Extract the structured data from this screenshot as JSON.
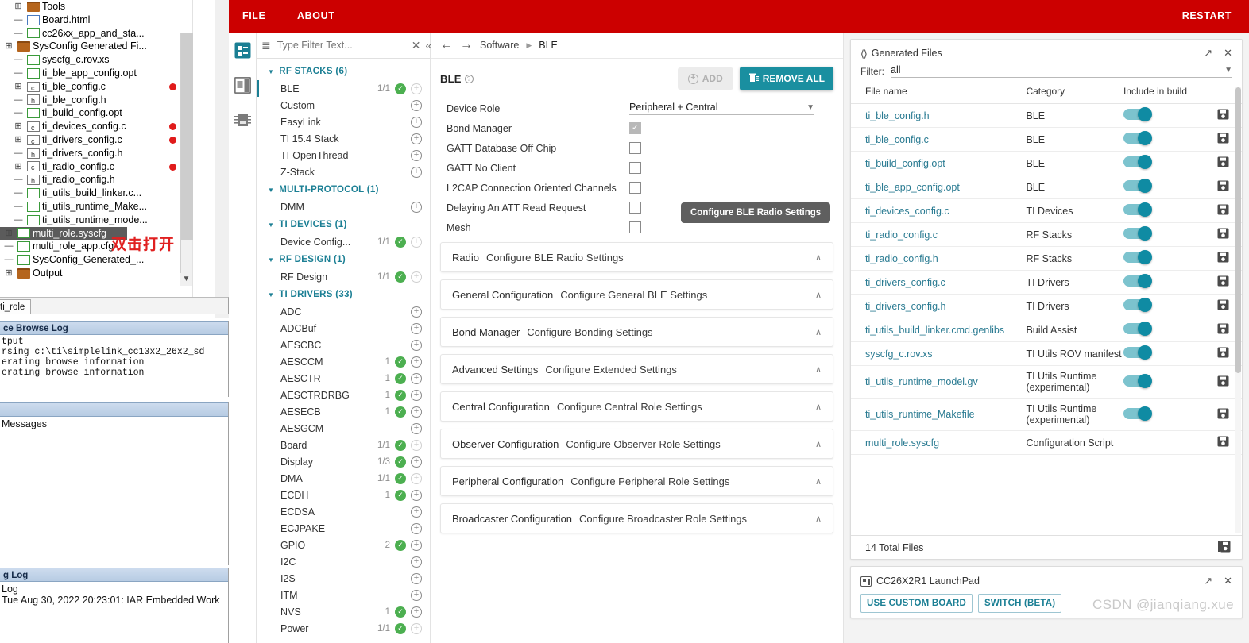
{
  "ide": {
    "tree": [
      {
        "depth": 1,
        "expander": "+",
        "icon": "folder",
        "label": "Tools",
        "dot": false
      },
      {
        "depth": 1,
        "expander": "-",
        "icon": "html",
        "label": "Board.html",
        "dot": false
      },
      {
        "depth": 1,
        "expander": "-",
        "icon": "file",
        "label": "cc26xx_app_and_sta...",
        "dot": false
      },
      {
        "depth": 0,
        "expander": "+",
        "icon": "folder",
        "label": "SysConfig Generated Fi...",
        "dot": false
      },
      {
        "depth": 1,
        "expander": "-",
        "icon": "file",
        "label": "syscfg_c.rov.xs",
        "dot": false
      },
      {
        "depth": 1,
        "expander": "-",
        "icon": "file",
        "label": "ti_ble_app_config.opt",
        "dot": false
      },
      {
        "depth": 1,
        "expander": "+",
        "icon": "c",
        "label": "ti_ble_config.c",
        "dot": true
      },
      {
        "depth": 1,
        "expander": "-",
        "icon": "h",
        "label": "ti_ble_config.h",
        "dot": false
      },
      {
        "depth": 1,
        "expander": "-",
        "icon": "file",
        "label": "ti_build_config.opt",
        "dot": false
      },
      {
        "depth": 1,
        "expander": "+",
        "icon": "c",
        "label": "ti_devices_config.c",
        "dot": true
      },
      {
        "depth": 1,
        "expander": "+",
        "icon": "c",
        "label": "ti_drivers_config.c",
        "dot": true
      },
      {
        "depth": 1,
        "expander": "-",
        "icon": "h",
        "label": "ti_drivers_config.h",
        "dot": false
      },
      {
        "depth": 1,
        "expander": "+",
        "icon": "c",
        "label": "ti_radio_config.c",
        "dot": true
      },
      {
        "depth": 1,
        "expander": "-",
        "icon": "h",
        "label": "ti_radio_config.h",
        "dot": false
      },
      {
        "depth": 1,
        "expander": "-",
        "icon": "file",
        "label": "ti_utils_build_linker.c...",
        "dot": false
      },
      {
        "depth": 1,
        "expander": "-",
        "icon": "file",
        "label": "ti_utils_runtime_Make...",
        "dot": false
      },
      {
        "depth": 1,
        "expander": "-",
        "icon": "file",
        "label": "ti_utils_runtime_mode...",
        "dot": false
      },
      {
        "depth": 0,
        "expander": "+",
        "icon": "file",
        "label": "multi_role.syscfg",
        "dot": false,
        "selected": true
      },
      {
        "depth": 0,
        "expander": "-",
        "icon": "file",
        "label": "multi_role_app.cfg",
        "dot": false
      },
      {
        "depth": 0,
        "expander": "-",
        "icon": "file",
        "label": "SysConfig_Generated_...",
        "dot": false
      },
      {
        "depth": 0,
        "expander": "+",
        "icon": "folder",
        "label": "Output",
        "dot": false
      }
    ],
    "annotation": "双击打开",
    "project_tab": "ti_role",
    "panes": [
      {
        "title": "ce Browse Log",
        "lines": [
          "tput",
          "rsing c:\\ti\\simplelink_cc13x2_26x2_sd",
          "erating browse information",
          "erating browse information"
        ],
        "mono": true
      },
      {
        "title": "",
        "lines": [
          "Messages"
        ],
        "mono": false
      },
      {
        "title": "g Log",
        "lines": [
          "Log",
          "Tue Aug 30, 2022 20:23:01: IAR Embedded Work"
        ],
        "mono": false
      }
    ]
  },
  "app": {
    "topbar": {
      "file": "FILE",
      "about": "ABOUT",
      "restart": "RESTART"
    },
    "rail": [
      {
        "name": "modules-icon"
      },
      {
        "name": "board-view-icon"
      },
      {
        "name": "chip-icon"
      }
    ],
    "filter": {
      "placeholder": "Type Filter Text...",
      "value": ""
    },
    "module_tree": [
      {
        "type": "group",
        "label": "RF STACKS (6)"
      },
      {
        "type": "item",
        "label": "BLE",
        "count": "1/1",
        "ok": true,
        "active": true,
        "plus_dim": true
      },
      {
        "type": "item",
        "label": "Custom",
        "count": "",
        "ok": false,
        "plus_dim": false
      },
      {
        "type": "item",
        "label": "EasyLink",
        "count": "",
        "ok": false,
        "plus_dim": false
      },
      {
        "type": "item",
        "label": "TI 15.4 Stack",
        "count": "",
        "ok": false,
        "plus_dim": false
      },
      {
        "type": "item",
        "label": "TI-OpenThread",
        "count": "",
        "ok": false,
        "plus_dim": false
      },
      {
        "type": "item",
        "label": "Z-Stack",
        "count": "",
        "ok": false,
        "plus_dim": false
      },
      {
        "type": "group",
        "label": "MULTI-PROTOCOL (1)"
      },
      {
        "type": "item",
        "label": "DMM",
        "count": "",
        "ok": false,
        "plus_dim": false
      },
      {
        "type": "group",
        "label": "TI DEVICES (1)"
      },
      {
        "type": "item",
        "label": "Device Config...",
        "count": "1/1",
        "ok": true,
        "plus_dim": true
      },
      {
        "type": "group",
        "label": "RF DESIGN (1)"
      },
      {
        "type": "item",
        "label": "RF Design",
        "count": "1/1",
        "ok": true,
        "plus_dim": true
      },
      {
        "type": "group",
        "label": "TI DRIVERS (33)"
      },
      {
        "type": "item",
        "label": "ADC",
        "count": "",
        "ok": false,
        "plus_dim": false
      },
      {
        "type": "item",
        "label": "ADCBuf",
        "count": "",
        "ok": false,
        "plus_dim": false
      },
      {
        "type": "item",
        "label": "AESCBC",
        "count": "",
        "ok": false,
        "plus_dim": false
      },
      {
        "type": "item",
        "label": "AESCCM",
        "count": "1",
        "ok": true,
        "plus_dim": false
      },
      {
        "type": "item",
        "label": "AESCTR",
        "count": "1",
        "ok": true,
        "plus_dim": false
      },
      {
        "type": "item",
        "label": "AESCTRDRBG",
        "count": "1",
        "ok": true,
        "plus_dim": false
      },
      {
        "type": "item",
        "label": "AESECB",
        "count": "1",
        "ok": true,
        "plus_dim": false
      },
      {
        "type": "item",
        "label": "AESGCM",
        "count": "",
        "ok": false,
        "plus_dim": false
      },
      {
        "type": "item",
        "label": "Board",
        "count": "1/1",
        "ok": true,
        "plus_dim": true
      },
      {
        "type": "item",
        "label": "Display",
        "count": "1/3",
        "ok": true,
        "plus_dim": false
      },
      {
        "type": "item",
        "label": "DMA",
        "count": "1/1",
        "ok": true,
        "plus_dim": true
      },
      {
        "type": "item",
        "label": "ECDH",
        "count": "1",
        "ok": true,
        "plus_dim": false
      },
      {
        "type": "item",
        "label": "ECDSA",
        "count": "",
        "ok": false,
        "plus_dim": false
      },
      {
        "type": "item",
        "label": "ECJPAKE",
        "count": "",
        "ok": false,
        "plus_dim": false
      },
      {
        "type": "item",
        "label": "GPIO",
        "count": "2",
        "ok": true,
        "plus_dim": false
      },
      {
        "type": "item",
        "label": "I2C",
        "count": "",
        "ok": false,
        "plus_dim": false
      },
      {
        "type": "item",
        "label": "I2S",
        "count": "",
        "ok": false,
        "plus_dim": false
      },
      {
        "type": "item",
        "label": "ITM",
        "count": "",
        "ok": false,
        "plus_dim": false
      },
      {
        "type": "item",
        "label": "NVS",
        "count": "1",
        "ok": true,
        "plus_dim": false
      },
      {
        "type": "item",
        "label": "Power",
        "count": "1/1",
        "ok": true,
        "plus_dim": true
      }
    ],
    "breadcrumb": {
      "root": "Software",
      "current": "BLE"
    },
    "config": {
      "title": "BLE",
      "add_label": "ADD",
      "remove_label": "REMOVE ALL",
      "properties": [
        {
          "label": "Device Role",
          "type": "select",
          "value": "Peripheral + Central"
        },
        {
          "label": "Bond Manager",
          "type": "checkbox",
          "checked": true,
          "disabled": true
        },
        {
          "label": "GATT Database Off Chip",
          "type": "checkbox",
          "checked": false
        },
        {
          "label": "GATT No Client",
          "type": "checkbox",
          "checked": false
        },
        {
          "label": "L2CAP Connection Oriented Channels",
          "type": "checkbox",
          "checked": false
        },
        {
          "label": "Delaying An ATT Read Request",
          "type": "checkbox",
          "checked": false
        },
        {
          "label": "Mesh",
          "type": "checkbox",
          "checked": false
        }
      ],
      "tooltip": "Configure BLE Radio Settings",
      "sections": [
        {
          "title": "Radio",
          "desc": "Configure BLE Radio Settings"
        },
        {
          "title": "General Configuration",
          "desc": "Configure General BLE Settings"
        },
        {
          "title": "Bond Manager",
          "desc": "Configure Bonding Settings"
        },
        {
          "title": "Advanced Settings",
          "desc": "Configure Extended Settings"
        },
        {
          "title": "Central Configuration",
          "desc": "Configure Central Role Settings"
        },
        {
          "title": "Observer Configuration",
          "desc": "Configure Observer Role Settings"
        },
        {
          "title": "Peripheral Configuration",
          "desc": "Configure Peripheral Role Settings"
        },
        {
          "title": "Broadcaster Configuration",
          "desc": "Configure Broadcaster Role Settings"
        }
      ]
    },
    "generated_files": {
      "title": "Generated Files",
      "filter_label": "Filter:",
      "filter_value": "all",
      "columns": [
        "File name",
        "Category",
        "Include in build"
      ],
      "rows": [
        {
          "name": "ti_ble_config.h",
          "category": "BLE",
          "include": true
        },
        {
          "name": "ti_ble_config.c",
          "category": "BLE",
          "include": true
        },
        {
          "name": "ti_build_config.opt",
          "category": "BLE",
          "include": true
        },
        {
          "name": "ti_ble_app_config.opt",
          "category": "BLE",
          "include": true
        },
        {
          "name": "ti_devices_config.c",
          "category": "TI Devices",
          "include": true
        },
        {
          "name": "ti_radio_config.c",
          "category": "RF Stacks",
          "include": true
        },
        {
          "name": "ti_radio_config.h",
          "category": "RF Stacks",
          "include": true
        },
        {
          "name": "ti_drivers_config.c",
          "category": "TI Drivers",
          "include": true
        },
        {
          "name": "ti_drivers_config.h",
          "category": "TI Drivers",
          "include": true
        },
        {
          "name": "ti_utils_build_linker.cmd.genlibs",
          "category": "Build Assist",
          "include": true
        },
        {
          "name": "syscfg_c.rov.xs",
          "category": "TI Utils ROV manifest",
          "include": true
        },
        {
          "name": "ti_utils_runtime_model.gv",
          "category": "TI Utils Runtime (experimental)",
          "include": true
        },
        {
          "name": "ti_utils_runtime_Makefile",
          "category": "TI Utils Runtime (experimental)",
          "include": true
        },
        {
          "name": "multi_role.syscfg",
          "category": "Configuration Script",
          "include": null
        }
      ],
      "total": "14 Total Files"
    },
    "launchpad": {
      "title": "CC26X2R1 LaunchPad",
      "buttons": [
        "USE CUSTOM BOARD",
        "SWITCH (BETA)"
      ]
    },
    "watermark": "CSDN @jianqiang.xue"
  },
  "colors": {
    "brand_red": "#cc0000",
    "teal": "#1a8fa0",
    "link_teal": "#2a7b92",
    "group_teal": "#1b7f94",
    "green_ok": "#4caf50",
    "red_dot": "#e01b1b"
  }
}
